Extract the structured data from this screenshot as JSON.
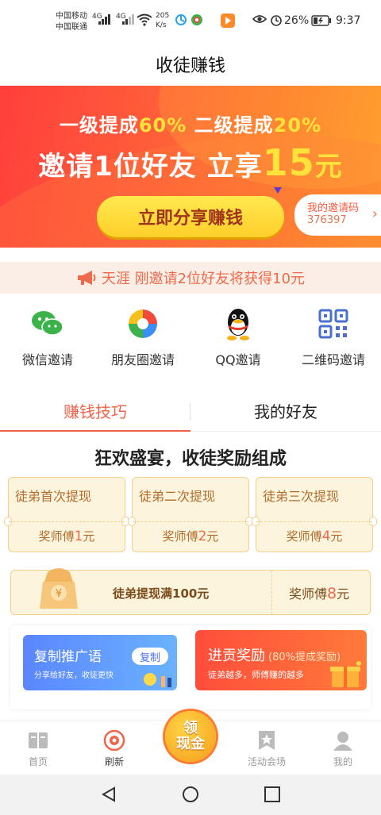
{
  "status_bar": {
    "carrier_1": "中国移动",
    "carrier_2": "中国联通",
    "net_1": "4G",
    "net_2": "4G",
    "speed_value": "205",
    "speed_unit": "K/s",
    "battery": "26%",
    "time": "9:37"
  },
  "header": {
    "title": "收徒赚钱"
  },
  "banner": {
    "line1_a": "一级提成",
    "line1_b": "60%",
    "line1_c": "二级提成",
    "line1_d": "20%",
    "line2_a": "邀请1位好友 立享",
    "line2_b": "15",
    "line2_c": "元",
    "share_button": "立即分享赚钱",
    "invite_code_label": "我的邀请码",
    "invite_code": "376397"
  },
  "notice": {
    "text": "天涯 刚邀请2位好友将获得10元"
  },
  "share_methods": [
    {
      "label": "微信邀请",
      "icon": "wechat-icon"
    },
    {
      "label": "朋友圈邀请",
      "icon": "moments-icon"
    },
    {
      "label": "QQ邀请",
      "icon": "qq-icon"
    },
    {
      "label": "二维码邀请",
      "icon": "qrcode-icon"
    }
  ],
  "tabs": [
    {
      "label": "赚钱技巧",
      "active": true
    },
    {
      "label": "我的好友",
      "active": false
    }
  ],
  "feast_title": "狂欢盛宴，收徒奖励组成",
  "reward_cards": [
    {
      "title": "徒弟首次提现",
      "prefix": "奖师傅",
      "amount": "1",
      "unit": "元"
    },
    {
      "title": "徒弟二次提现",
      "prefix": "奖师傅",
      "amount": "2",
      "unit": "元"
    },
    {
      "title": "徒弟三次提现",
      "prefix": "奖师傅",
      "amount": "4",
      "unit": "元"
    }
  ],
  "wide_card": {
    "title": "徒弟提现满100元",
    "prefix": "奖师傅",
    "amount": "8",
    "unit": "元",
    "bag_symbol": "¥"
  },
  "promo": {
    "left_title": "复制推广语",
    "left_sub": "分享给好友，收徒更快",
    "left_button": "复制",
    "right_title": "进贡奖励",
    "right_title_small": "(80%提成奖励)",
    "right_sub": "徒弟越多，师傅赚的越多"
  },
  "bottom_nav": {
    "items": [
      {
        "label": "首页",
        "icon": "book-icon"
      },
      {
        "label": "刷新",
        "icon": "refresh-target-icon"
      },
      {
        "label": "活动会场",
        "icon": "star-bookmark-icon"
      },
      {
        "label": "我的",
        "icon": "person-icon"
      }
    ],
    "center_line1": "领",
    "center_line2": "现金"
  },
  "colors": {
    "accent": "#f0644a",
    "banner_start": "#ff3f3c",
    "banner_end": "#ff9a2a",
    "gold": "#ffe23a"
  }
}
